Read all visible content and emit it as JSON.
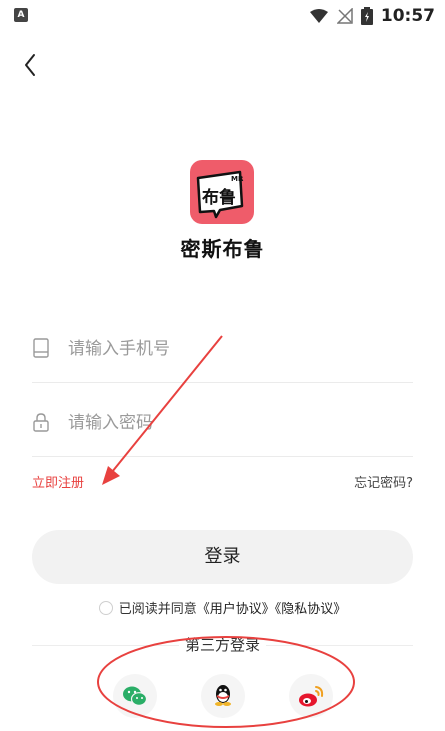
{
  "status_bar": {
    "left_icon": "A",
    "time": "10:57",
    "icons": [
      "wifi-icon",
      "no-sim-icon",
      "battery-icon"
    ]
  },
  "app": {
    "name": "密斯布鲁",
    "logo_text": "布鲁",
    "logo_small": "MR",
    "logo_color": "#ef5c6a"
  },
  "form": {
    "phone_placeholder": "请输入手机号",
    "password_placeholder": "请输入密码",
    "register_label": "立即注册",
    "forgot_label": "忘记密码?",
    "login_label": "登录"
  },
  "agreement": {
    "prefix": "已阅读并同意",
    "user_agreement": "《用户协议》",
    "privacy_policy": "《隐私协议》"
  },
  "third_party": {
    "title": "第三方登录",
    "providers": [
      "wechat",
      "qq",
      "weibo"
    ]
  },
  "colors": {
    "accent_red": "#e8413f",
    "login_bg": "#f2f2f2"
  }
}
